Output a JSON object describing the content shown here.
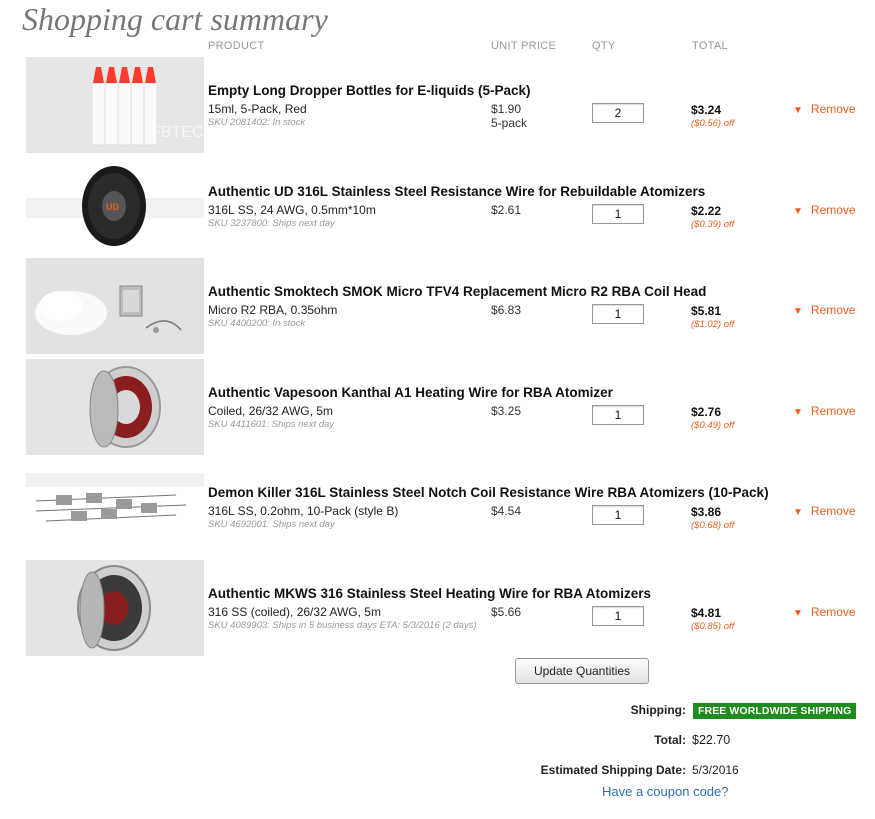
{
  "page": {
    "title": "Shopping cart summary"
  },
  "columns": {
    "product": "PRODUCT",
    "unit_price": "UNIT PRICE",
    "qty": "QTY",
    "total": "TOTAL"
  },
  "items": [
    {
      "name": "Empty Long Dropper Bottles for E-liquids (5-Pack)",
      "options": "15ml, 5-Pack, Red",
      "sku": "SKU 2081402: In stock",
      "unit_price": "$1.90",
      "unit_note": "5-pack",
      "qty": "2",
      "total": "$3.24",
      "savings": "($0.56) off",
      "remove": "Remove",
      "image_icon": "dropper-bottles"
    },
    {
      "name": "Authentic UD 316L Stainless Steel Resistance Wire for Rebuildable Atomizers",
      "options": "316L SS, 24 AWG, 0.5mm*10m",
      "sku": "SKU 3237800: Ships next day",
      "unit_price": "$2.61",
      "unit_note": "",
      "qty": "1",
      "total": "$2.22",
      "savings": "($0.39) off",
      "remove": "Remove",
      "image_icon": "wire-spool"
    },
    {
      "name": "Authentic Smoktech SMOK Micro TFV4 Replacement Micro R2 RBA Coil Head",
      "options": "Micro R2 RBA, 0.35ohm",
      "sku": "SKU 4400200: In stock",
      "unit_price": "$6.83",
      "unit_note": "",
      "qty": "1",
      "total": "$5.81",
      "savings": "($1.02) off",
      "remove": "Remove",
      "image_icon": "coil-head"
    },
    {
      "name": "Authentic Vapesoon Kanthal A1 Heating Wire for RBA Atomizer",
      "options": "Coiled, 26/32 AWG, 5m",
      "sku": "SKU 4411601: Ships next day",
      "unit_price": "$3.25",
      "unit_note": "",
      "qty": "1",
      "total": "$2.76",
      "savings": "($0.49) off",
      "remove": "Remove",
      "image_icon": "wire-reel"
    },
    {
      "name": "Demon Killer 316L Stainless Steel Notch Coil Resistance Wire RBA Atomizers (10-Pack)",
      "options": "316L SS, 0.2ohm, 10-Pack (style B)",
      "sku": "SKU 4692001: Ships next day",
      "unit_price": "$4.54",
      "unit_note": "",
      "qty": "1",
      "total": "$3.86",
      "savings": "($0.68) off",
      "remove": "Remove",
      "image_icon": "notch-coils"
    },
    {
      "name": "Authentic MKWS 316 Stainless Steel Heating Wire for RBA Atomizers",
      "options": "316 SS (coiled), 26/32 AWG, 5m",
      "sku": "SKU 4089903: Ships in 5 business days ETA: 5/3/2016 (2 days)",
      "unit_price": "$5.66",
      "unit_note": "",
      "qty": "1",
      "total": "$4.81",
      "savings": "($0.85) off",
      "remove": "Remove",
      "image_icon": "wire-reel-dark"
    }
  ],
  "update_button": "Update Quantities",
  "summary": {
    "shipping_label": "Shipping:",
    "shipping_badge": "FREE WORLDWIDE SHIPPING",
    "total_label": "Total:",
    "total_value": "$22.70",
    "est_label": "Estimated Shipping Date:",
    "est_value": "5/3/2016",
    "coupon": "Have a coupon code?"
  },
  "colors": {
    "accent": "#e8601c",
    "link": "#2f6fb5",
    "badge": "#1f8c1f"
  }
}
